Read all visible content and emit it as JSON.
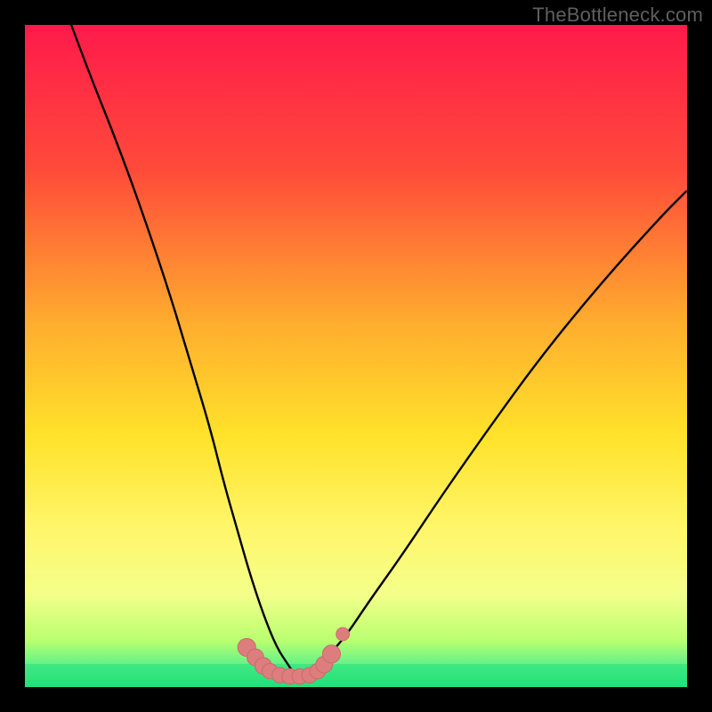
{
  "watermark": "TheBottleneck.com",
  "colors": {
    "frame": "#000000",
    "curve": "#000000",
    "marker_fill": "#de7d7d",
    "marker_stroke": "#c96a6a",
    "green_band": "#24e07a"
  },
  "chart_data": {
    "type": "line",
    "title": "",
    "xlabel": "",
    "ylabel": "",
    "xlim": [
      0,
      100
    ],
    "ylim": [
      0,
      100
    ],
    "gradient_stops": [
      {
        "pct": 0,
        "color": "#ff1a4b"
      },
      {
        "pct": 22,
        "color": "#ff4b3a"
      },
      {
        "pct": 45,
        "color": "#ffad2e"
      },
      {
        "pct": 62,
        "color": "#ffe22a"
      },
      {
        "pct": 76,
        "color": "#fff66a"
      },
      {
        "pct": 86,
        "color": "#f4ff8a"
      },
      {
        "pct": 93,
        "color": "#b9ff70"
      },
      {
        "pct": 97,
        "color": "#5af08a"
      },
      {
        "pct": 100,
        "color": "#1fe07a"
      }
    ],
    "series": [
      {
        "name": "left-curve",
        "x": [
          7,
          10,
          14,
          18,
          22,
          25,
          28,
          30,
          32,
          34,
          36,
          38,
          40,
          41
        ],
        "y": [
          100,
          92,
          82,
          71,
          59,
          49,
          39,
          31,
          24,
          17,
          11,
          6,
          3,
          1.5
        ]
      },
      {
        "name": "right-curve",
        "x": [
          41,
          44,
          48,
          52,
          57,
          63,
          70,
          78,
          87,
          96,
          100
        ],
        "y": [
          1.5,
          3,
          7,
          13,
          20,
          29,
          39,
          50,
          61,
          71,
          75
        ]
      }
    ],
    "markers": [
      {
        "x": 33.5,
        "y": 6.0,
        "r": 1.5
      },
      {
        "x": 34.8,
        "y": 4.5,
        "r": 1.4
      },
      {
        "x": 36.0,
        "y": 3.2,
        "r": 1.4
      },
      {
        "x": 37.0,
        "y": 2.4,
        "r": 1.3
      },
      {
        "x": 38.5,
        "y": 1.8,
        "r": 1.3
      },
      {
        "x": 40.0,
        "y": 1.6,
        "r": 1.3
      },
      {
        "x": 41.5,
        "y": 1.6,
        "r": 1.3
      },
      {
        "x": 43.0,
        "y": 1.8,
        "r": 1.3
      },
      {
        "x": 44.2,
        "y": 2.4,
        "r": 1.3
      },
      {
        "x": 45.2,
        "y": 3.4,
        "r": 1.4
      },
      {
        "x": 46.3,
        "y": 5.0,
        "r": 1.5
      },
      {
        "x": 48.0,
        "y": 8.0,
        "r": 1.1
      }
    ],
    "green_band_y": [
      0,
      3.5
    ]
  }
}
